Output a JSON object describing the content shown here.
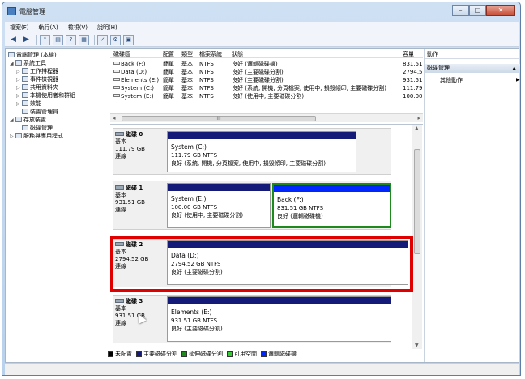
{
  "window": {
    "title": "電腦管理",
    "controls": {
      "minimize": "–",
      "maximize": "□",
      "close": "✕"
    }
  },
  "menu": [
    "檔案(F)",
    "執行(A)",
    "檢視(V)",
    "說明(H)"
  ],
  "toolbar_icons": [
    "back-arrow-icon",
    "forward-arrow-icon",
    "up-folder-icon",
    "show-hide-tree-icon",
    "help-icon",
    "properties-icon",
    "refresh-icon",
    "settings-icon"
  ],
  "tree": {
    "root": "電腦管理 (本機)",
    "items": [
      {
        "label": "系統工具",
        "level": 1,
        "expanded": true
      },
      {
        "label": "工作排程器",
        "level": 2
      },
      {
        "label": "事件檢視器",
        "level": 2
      },
      {
        "label": "共用資料夾",
        "level": 2
      },
      {
        "label": "本機使用者和群組",
        "level": 2
      },
      {
        "label": "效能",
        "level": 2
      },
      {
        "label": "裝置管理員",
        "level": 2
      },
      {
        "label": "存放裝置",
        "level": 1,
        "expanded": true
      },
      {
        "label": "磁碟管理",
        "level": 2
      },
      {
        "label": "服務與應用程式",
        "level": 1
      }
    ]
  },
  "volume_list": {
    "headers": [
      "磁碟區",
      "配置",
      "類型",
      "檔案系統",
      "狀態",
      "容量"
    ],
    "rows": [
      [
        "Back (F:)",
        "簡單",
        "基本",
        "NTFS",
        "良好 (邏輯磁碟機)",
        "831.51"
      ],
      [
        "Data (D:)",
        "簡單",
        "基本",
        "NTFS",
        "良好 (主要磁碟分割)",
        "2794.5"
      ],
      [
        "Elements (E:)",
        "簡單",
        "基本",
        "NTFS",
        "良好 (主要磁碟分割)",
        "931.51"
      ],
      [
        "System (C:)",
        "簡單",
        "基本",
        "NTFS",
        "良好 (系統, 開機, 分頁檔案, 使用中, 損毀傾印, 主要磁碟分割)",
        "111.79"
      ],
      [
        "System (E:)",
        "簡單",
        "基本",
        "NTFS",
        "良好 (使用中, 主要磁碟分割)",
        "100.00"
      ]
    ],
    "scroll_label": "III"
  },
  "disks": [
    {
      "name": "磁碟 0",
      "type": "基本",
      "size": "111.79 GB",
      "status": "連線",
      "partitions": [
        {
          "name": "System (C:)",
          "size": "111.79 GB NTFS",
          "status": "良好 (系統, 開機, 分頁檔案, 使用中, 損毀傾印, 主要磁碟分割)",
          "kind": "primary"
        }
      ]
    },
    {
      "name": "磁碟 1",
      "type": "基本",
      "size": "931.51 GB",
      "status": "連線",
      "partitions": [
        {
          "name": "System (E:)",
          "size": "100.00 GB NTFS",
          "status": "良好 (使用中, 主要磁碟分割)",
          "kind": "primary"
        },
        {
          "name": "Back (F:)",
          "size": "831.51 GB NTFS",
          "status": "良好 (邏輯磁碟機)",
          "kind": "logical"
        }
      ]
    },
    {
      "name": "磁碟 2",
      "type": "基本",
      "size": "2794.52 GB",
      "status": "連線",
      "partitions": [
        {
          "name": "Data (D:)",
          "size": "2794.52 GB NTFS",
          "status": "良好 (主要磁碟分割)",
          "kind": "primary"
        }
      ]
    },
    {
      "name": "磁碟 3",
      "type": "基本",
      "size": "931.51 GB",
      "status": "連線",
      "partitions": [
        {
          "name": "Elements (E:)",
          "size": "931.51 GB NTFS",
          "status": "良好 (主要磁碟分割)",
          "kind": "primary"
        }
      ]
    }
  ],
  "legend": [
    {
      "label": "未配置",
      "color": "#000000"
    },
    {
      "label": "主要磁碟分割",
      "color": "#131a78"
    },
    {
      "label": "延伸磁碟分割",
      "color": "#1e8a1e"
    },
    {
      "label": "可用空間",
      "color": "#33cc33"
    },
    {
      "label": "邏輯磁碟機",
      "color": "#0026ff"
    }
  ],
  "actions": {
    "header": "動作",
    "section": "磁碟管理",
    "item": "其他動作"
  }
}
